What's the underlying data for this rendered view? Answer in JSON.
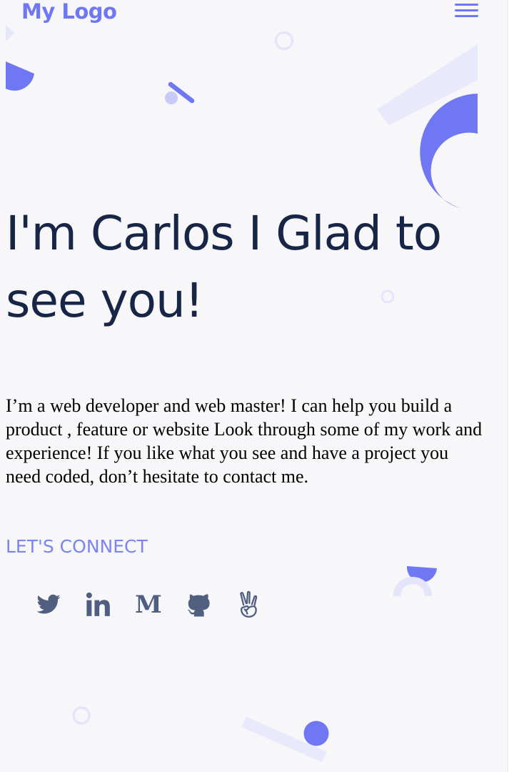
{
  "header": {
    "logo_text": "My Logo",
    "menu_icon": "hamburger-menu-icon"
  },
  "hero": {
    "headline_line1": "I'm Carlos I Glad to",
    "headline_line2": "see you!",
    "intro": "I’m a web developer and web master! I can help you build a product , feature or website Look through some of my work and experience! If you like what you see and have a project you need coded, don’t hesitate to contact me."
  },
  "connect": {
    "heading": "LET'S CONNECT",
    "links": [
      {
        "name": "Twitter",
        "icon": "twitter-icon"
      },
      {
        "name": "LinkedIn",
        "icon": "linkedin-icon"
      },
      {
        "name": "Medium",
        "icon": "medium-icon",
        "glyph": "M"
      },
      {
        "name": "GitHub",
        "icon": "github-icon"
      },
      {
        "name": "AngelList",
        "icon": "angellist-icon"
      }
    ]
  },
  "colors": {
    "accent": "#6f78f2",
    "heading": "#172646",
    "icon": "#505e80",
    "background": "#f7f6f9"
  }
}
